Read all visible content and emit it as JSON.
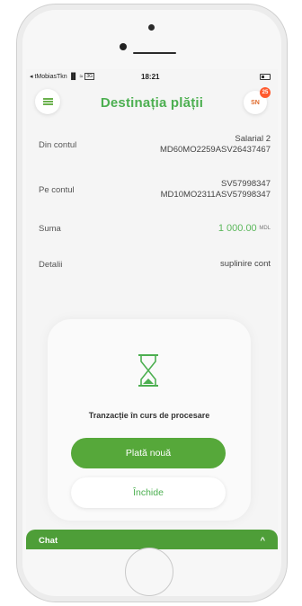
{
  "statusbar": {
    "carrier": "◂ tMobiasTkn",
    "signal": "▐▌",
    "wifi": "≈",
    "lte": "3G",
    "time": "18:21"
  },
  "header": {
    "title": "Destinația plății",
    "avatar_initials": "SN",
    "badge_count": "25"
  },
  "details": [
    {
      "label": "Din contul",
      "line1": "Salarial 2",
      "line2": "MD60MO2259ASV26437467"
    },
    {
      "label": "Pe contul",
      "line1": "SV57998347",
      "line2": "MD10MO2311ASV57998347"
    }
  ],
  "sum": {
    "label": "Suma",
    "amount": "1 000.00",
    "currency": "MDL"
  },
  "info": {
    "label": "Detalii",
    "value": "suplinire cont"
  },
  "card": {
    "status_text": "Tranzacție în curs de procesare",
    "new_payment_label": "Plată nouă",
    "close_label": "Închide"
  },
  "chat": {
    "label": "Chat",
    "toggle": "^"
  },
  "colors": {
    "accent": "#4caf50",
    "button": "#56a83a",
    "chatbar": "#4e9e38",
    "badge": "#ff5a2e"
  }
}
